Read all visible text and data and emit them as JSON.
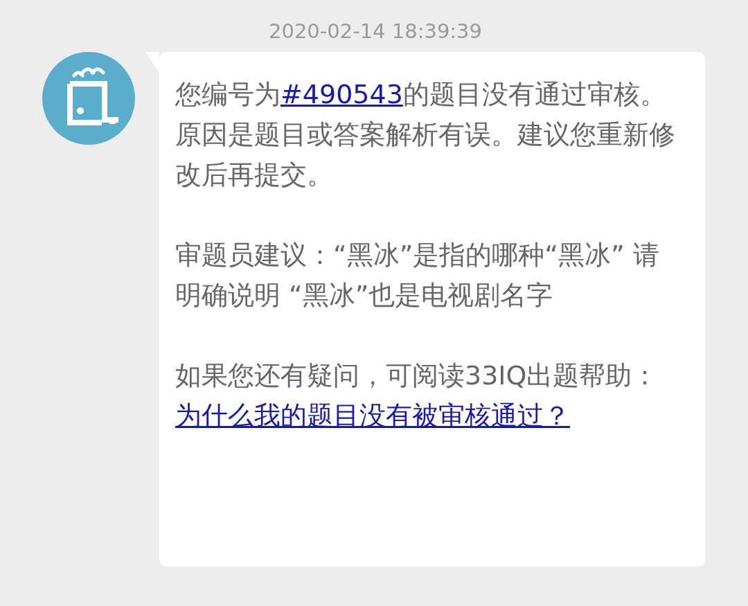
{
  "timestamp": "2020-02-14 18:39:39",
  "message": {
    "paragraphs": [
      [
        {
          "kind": "text",
          "text": "您编号为"
        },
        {
          "kind": "link",
          "text": "#490543"
        },
        {
          "kind": "text",
          "text": "的题目没有通过审核。原因是题目或答案解析有误。建议您重新修改后再提交。"
        }
      ],
      [
        {
          "kind": "text",
          "text": "审题员建议：“黑冰”是指的哪种“黑冰” 请明确说明 “黑冰”也是电视剧名字"
        }
      ],
      [
        {
          "kind": "text",
          "text": "如果您还有疑问，可阅读33IQ出题帮助："
        },
        {
          "kind": "link",
          "text": "为什么我的题目没有被审核通过？"
        }
      ]
    ]
  }
}
